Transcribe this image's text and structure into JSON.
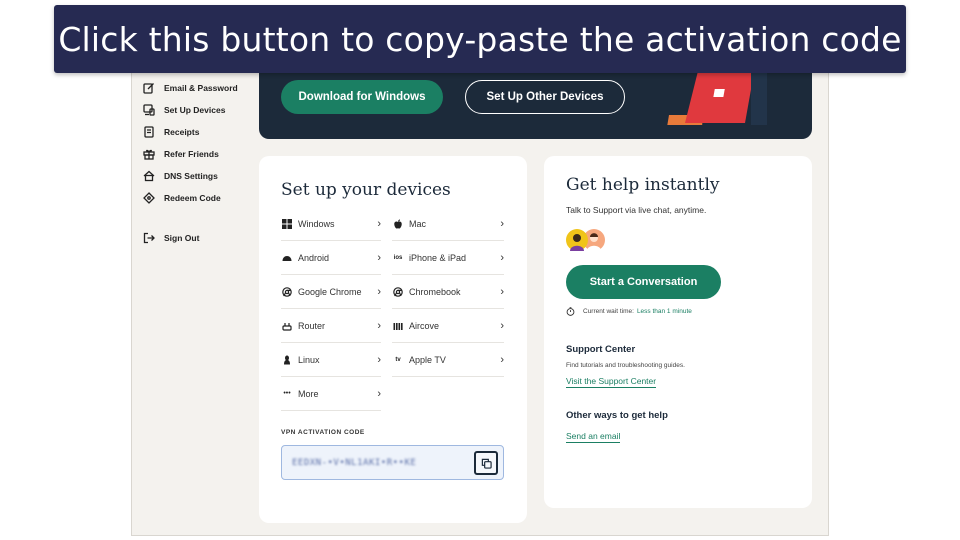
{
  "caption": "Click this button to copy-paste the activation code",
  "sidebar": {
    "items": [
      {
        "label": "Email & Password",
        "icon": "edit-icon"
      },
      {
        "label": "Set Up Devices",
        "icon": "devices-icon"
      },
      {
        "label": "Receipts",
        "icon": "receipt-icon"
      },
      {
        "label": "Refer Friends",
        "icon": "gift-icon"
      },
      {
        "label": "DNS Settings",
        "icon": "dns-icon"
      },
      {
        "label": "Redeem Code",
        "icon": "tag-icon"
      }
    ],
    "sign_out": {
      "label": "Sign Out",
      "icon": "sign-out-icon"
    }
  },
  "banner": {
    "download_button": "Download for Windows",
    "other_devices_button": "Set Up Other Devices"
  },
  "devices": {
    "title": "Set up your devices",
    "left": [
      {
        "label": "Windows",
        "icon": "windows-icon",
        "glyph": "⊞"
      },
      {
        "label": "Android",
        "icon": "android-icon",
        "glyph": "☁"
      },
      {
        "label": "Google Chrome",
        "icon": "chrome-icon",
        "glyph": "◎"
      },
      {
        "label": "Router",
        "icon": "router-icon",
        "glyph": "⌂"
      },
      {
        "label": "Linux",
        "icon": "linux-icon",
        "glyph": "♙"
      },
      {
        "label": "More",
        "icon": "more-icon",
        "glyph": "•••"
      }
    ],
    "right": [
      {
        "label": "Mac",
        "icon": "apple-icon",
        "glyph": ""
      },
      {
        "label": "iPhone & iPad",
        "icon": "ios-icon",
        "glyph": "ios"
      },
      {
        "label": "Chromebook",
        "icon": "chromebook-icon",
        "glyph": "◎"
      },
      {
        "label": "Aircove",
        "icon": "aircove-icon",
        "glyph": "▥"
      },
      {
        "label": "Apple TV",
        "icon": "apple-tv-icon",
        "glyph": "tv"
      }
    ],
    "chevron": "›",
    "activation_code_label": "VPN ACTIVATION CODE",
    "activation_code_value": "EEDXN-•V•NL1AKI•R••KE"
  },
  "help": {
    "title": "Get help instantly",
    "subtitle": "Talk to Support via live chat, anytime.",
    "conversation_button": "Start a Conversation",
    "wait_label": "Current wait time:",
    "wait_value": "Less than 1 minute",
    "support_center_title": "Support Center",
    "support_center_sub": "Find tutorials and troubleshooting guides.",
    "support_center_link": "Visit the Support Center",
    "other_ways_title": "Other ways to get help",
    "email_link": "Send an email"
  },
  "colors": {
    "brand_green": "#1b7f63",
    "banner_navy": "#1c2a3a",
    "caption_bg": "#262a52",
    "page_bg": "#f4f2ee",
    "laptop_red": "#e0393e"
  }
}
